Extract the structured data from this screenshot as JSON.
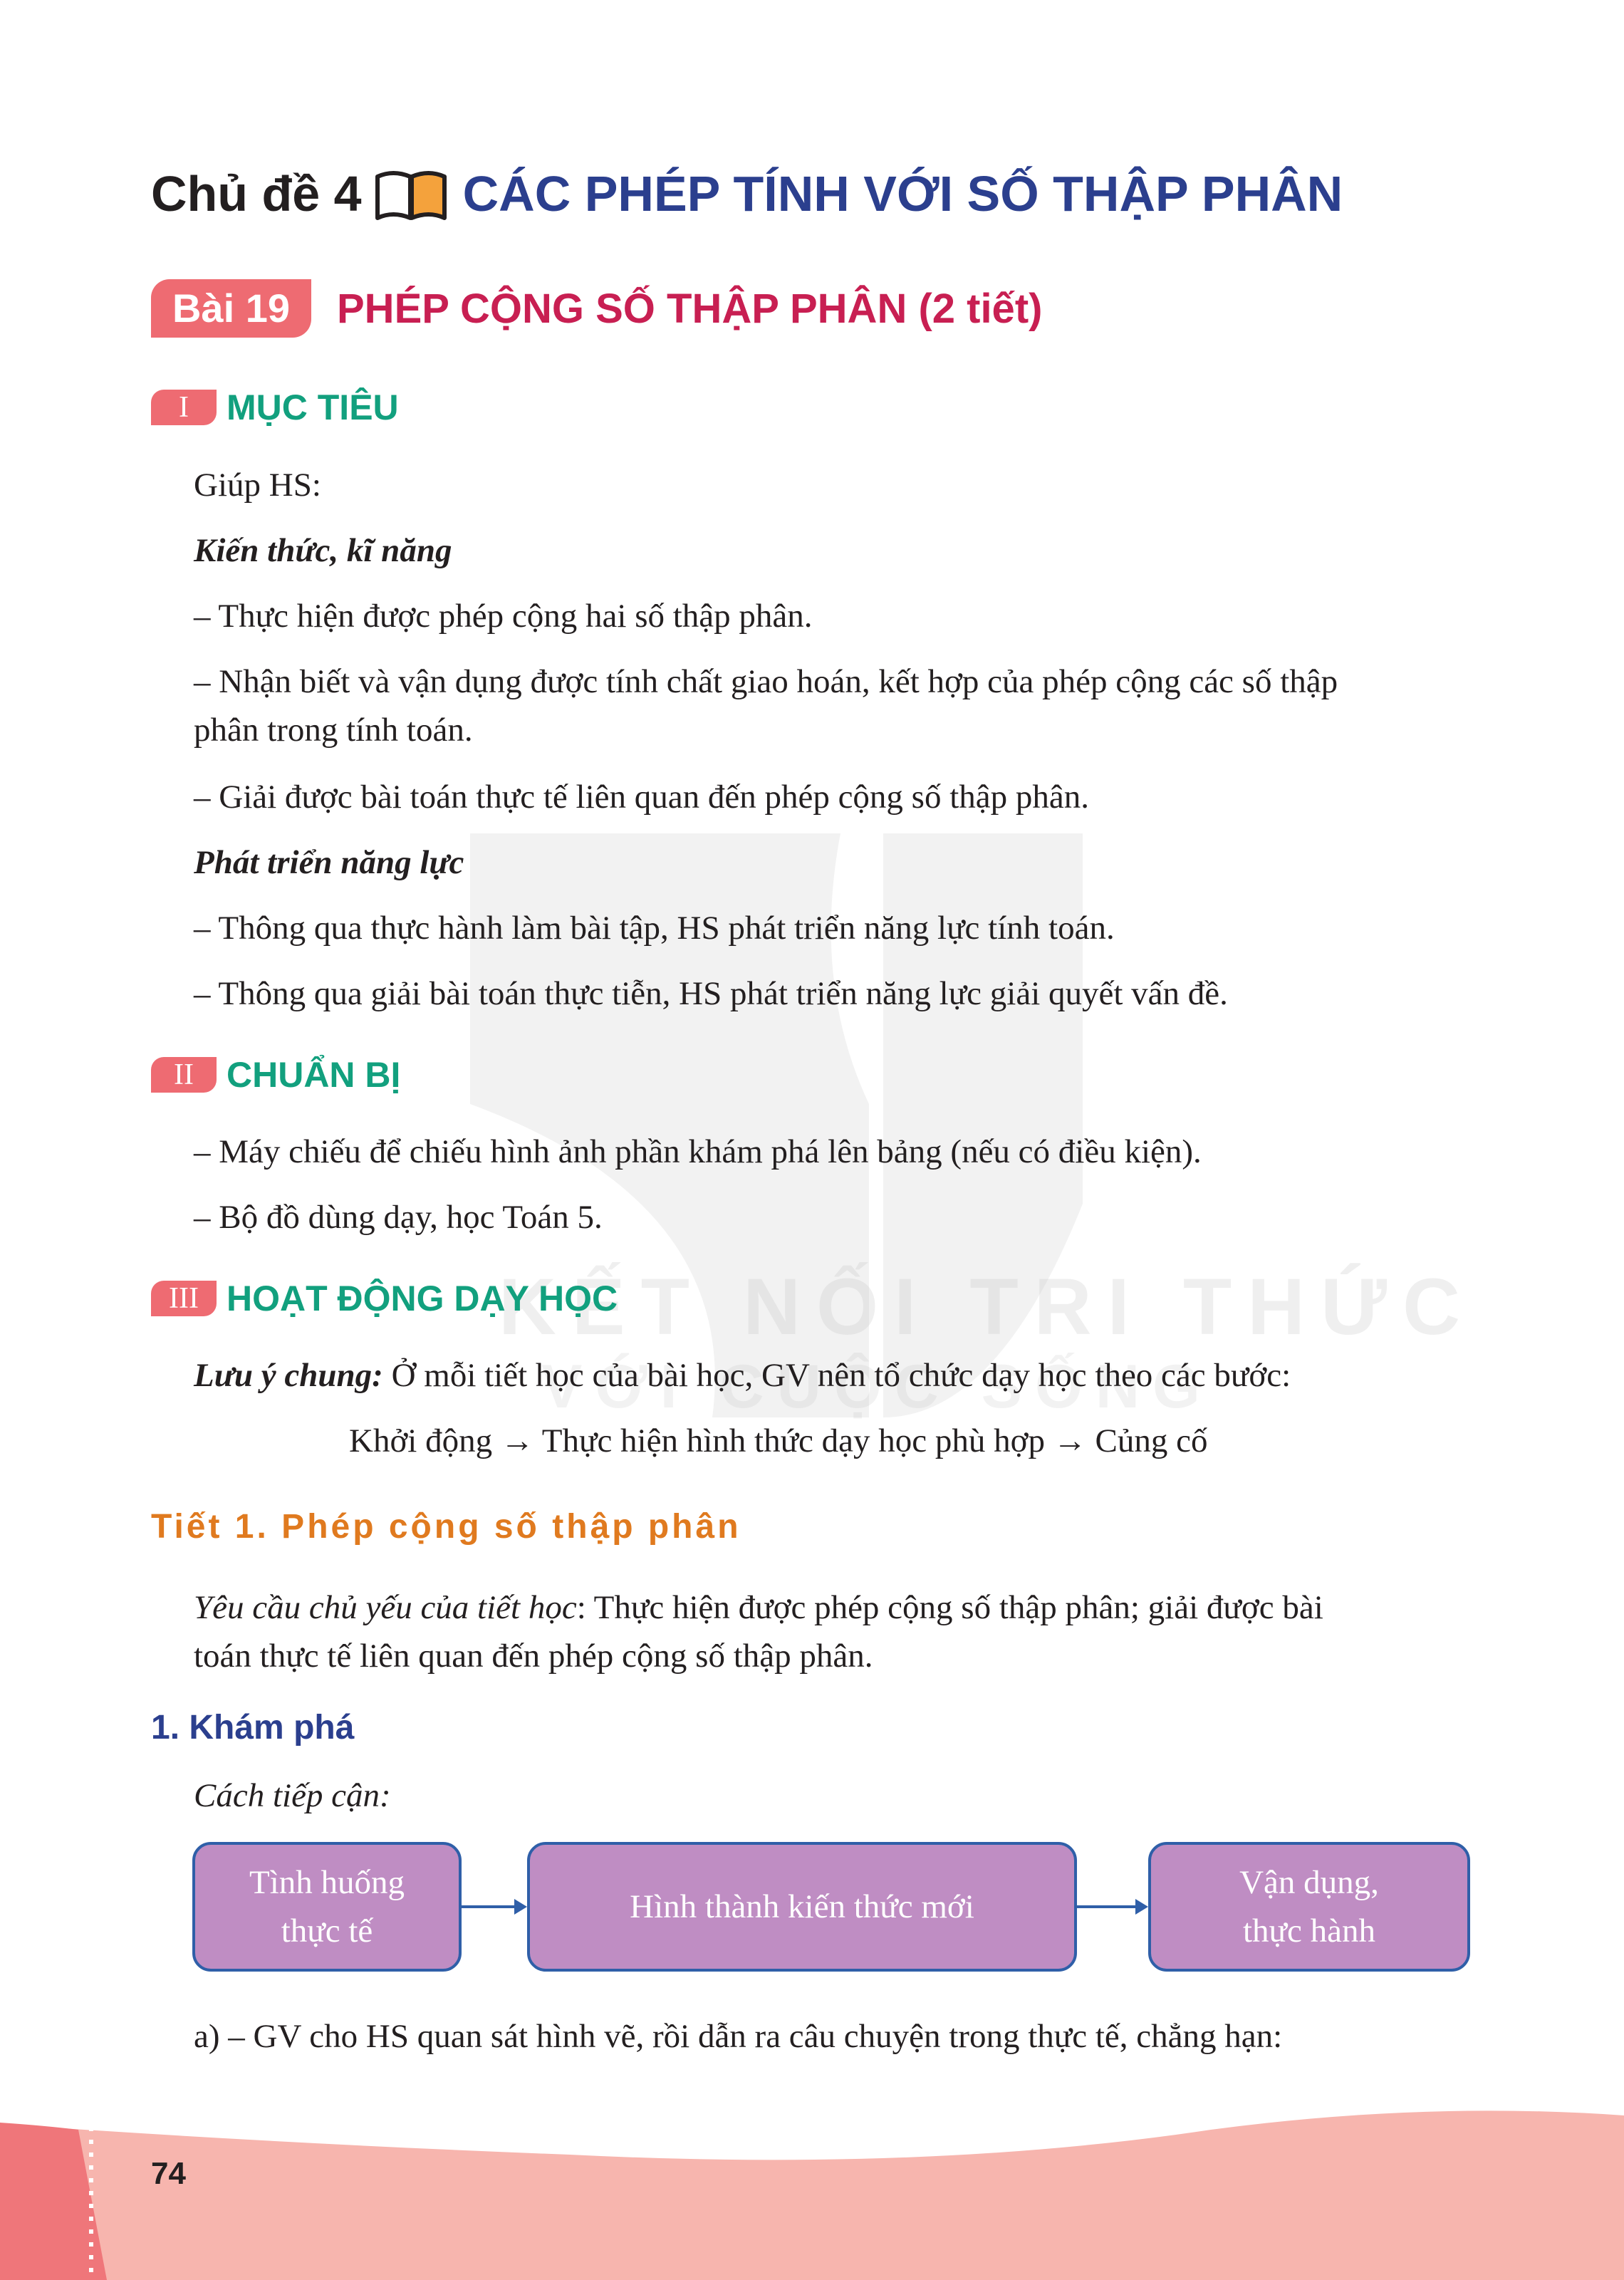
{
  "topic": {
    "prefix": "Chủ đề 4",
    "title": "CÁC PHÉP TÍNH VỚI SỐ THẬP PHÂN"
  },
  "lesson": {
    "badge": "Bài 19",
    "title": "PHÉP CỘNG SỐ THẬP PHÂN (2 tiết)"
  },
  "section1": {
    "num": "I",
    "title": "MỤC TIÊU",
    "intro": "Giúp HS:",
    "sub1": "Kiến thức, kĩ năng",
    "items1": [
      "– Thực hiện được phép cộng hai số thập phân.",
      "– Nhận biết và vận dụng được tính chất giao hoán, kết hợp của phép cộng các số thập",
      "phân trong tính toán.",
      "– Giải được bài toán thực tế liên quan đến phép cộng số thập phân."
    ],
    "sub2": "Phát triển năng lực",
    "items2": [
      "– Thông qua thực hành làm bài tập, HS phát triển năng lực tính toán.",
      "– Thông qua giải bài toán thực tiễn, HS phát triển năng lực giải quyết vấn đề."
    ]
  },
  "section2": {
    "num": "II",
    "title": "CHUẨN BỊ",
    "items": [
      "– Máy chiếu để chiếu hình ảnh phần khám phá lên bảng (nếu có điều kiện).",
      "– Bộ đồ dùng dạy, học Toán 5."
    ]
  },
  "section3": {
    "num": "III",
    "title": "HOẠT ĐỘNG DẠY HỌC",
    "note_label": "Lưu ý chung:",
    "note_text": " Ở mỗi tiết học của bài học, GV nên tổ chức dạy học theo các bước:",
    "flow": "Khởi động → Thực hiện hình thức dạy học phù hợp → Củng cố"
  },
  "tiet1": {
    "title": "Tiết 1. Phép cộng số thập phân",
    "req_label": "Yêu cầu chủ yếu của tiết học",
    "req_text": ": Thực hiện được phép cộng số thập phân; giải được bài",
    "req_text2": "toán thực tế liên quan đến phép cộng số thập phân."
  },
  "khampha": {
    "title": "1. Khám phá",
    "approach": "Cách tiếp cận:",
    "boxes": [
      {
        "line1": "Tình huống",
        "line2": "thực tế"
      },
      {
        "line1": "Hình thành kiến thức mới",
        "line2": ""
      },
      {
        "line1": "Vận dụng,",
        "line2": "thực hành"
      }
    ],
    "step_a": "a) – GV cho HS quan sát hình vẽ, rồi dẫn ra câu chuyện trong thực tế, chẳng hạn:"
  },
  "watermark": {
    "line1": "KẾT NỐI TRI THỨC",
    "line2": "VỚI CUỘC SỐNG"
  },
  "page_number": "74",
  "colors": {
    "topic_blue": "#2b3f8e",
    "lesson_red": "#c81f52",
    "badge_pink": "#ee6b72",
    "section_green": "#12a07e",
    "tiet_orange": "#e07a1f",
    "box_purple": "#bf8dc3",
    "box_border": "#2f5fa8",
    "footer_pink": "#f7b5ae"
  }
}
